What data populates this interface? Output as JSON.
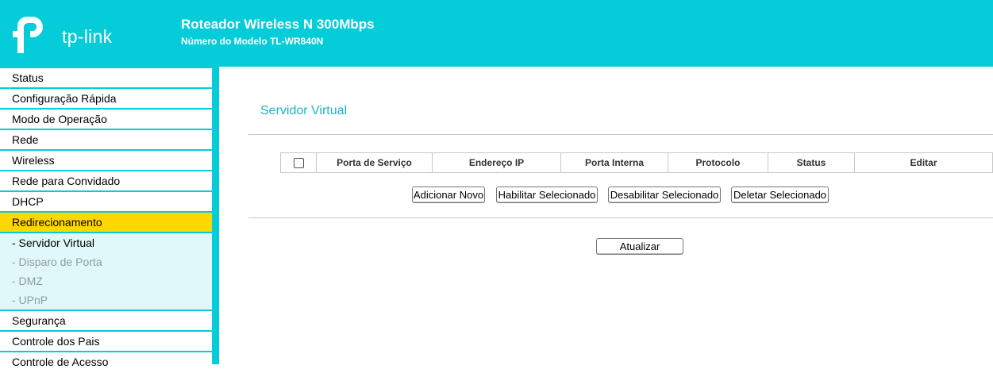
{
  "header": {
    "logo_text": "tp-link",
    "title": "Roteador Wireless N 300Mbps",
    "model": "Número do Modelo TL-WR840N",
    "background_color": "#04ccd8"
  },
  "sidebar": {
    "items_before": [
      {
        "label": "Status"
      },
      {
        "label": "Configuração Rápida"
      },
      {
        "label": "Modo de Operação"
      },
      {
        "label": "Rede"
      },
      {
        "label": "Wireless"
      },
      {
        "label": "Rede para Convidado"
      },
      {
        "label": "DHCP"
      }
    ],
    "active_item": {
      "label": "Redirecionamento",
      "highlight_color": "#ffd700"
    },
    "subitems": [
      {
        "label": "- Servidor Virtual"
      },
      {
        "label": "- Disparo de Porta"
      },
      {
        "label": "- DMZ"
      },
      {
        "label": "- UPnP"
      }
    ],
    "items_after": [
      {
        "label": "Segurança"
      },
      {
        "label": "Controle dos Pais"
      },
      {
        "label": "Controle de Acesso"
      }
    ]
  },
  "main": {
    "page_title": "Servidor Virtual",
    "table": {
      "columns": [
        "Porta de Serviço",
        "Endereço IP",
        "Porta Interna",
        "Protocolo",
        "Status",
        "Editar"
      ]
    },
    "buttons": {
      "add_new": "Adicionar Novo",
      "enable_selected": "Habilitar Selecionado",
      "disable_selected": "Desabilitar Selecionado",
      "delete_selected": "Deletar Selecionado",
      "refresh": "Atualizar"
    }
  }
}
